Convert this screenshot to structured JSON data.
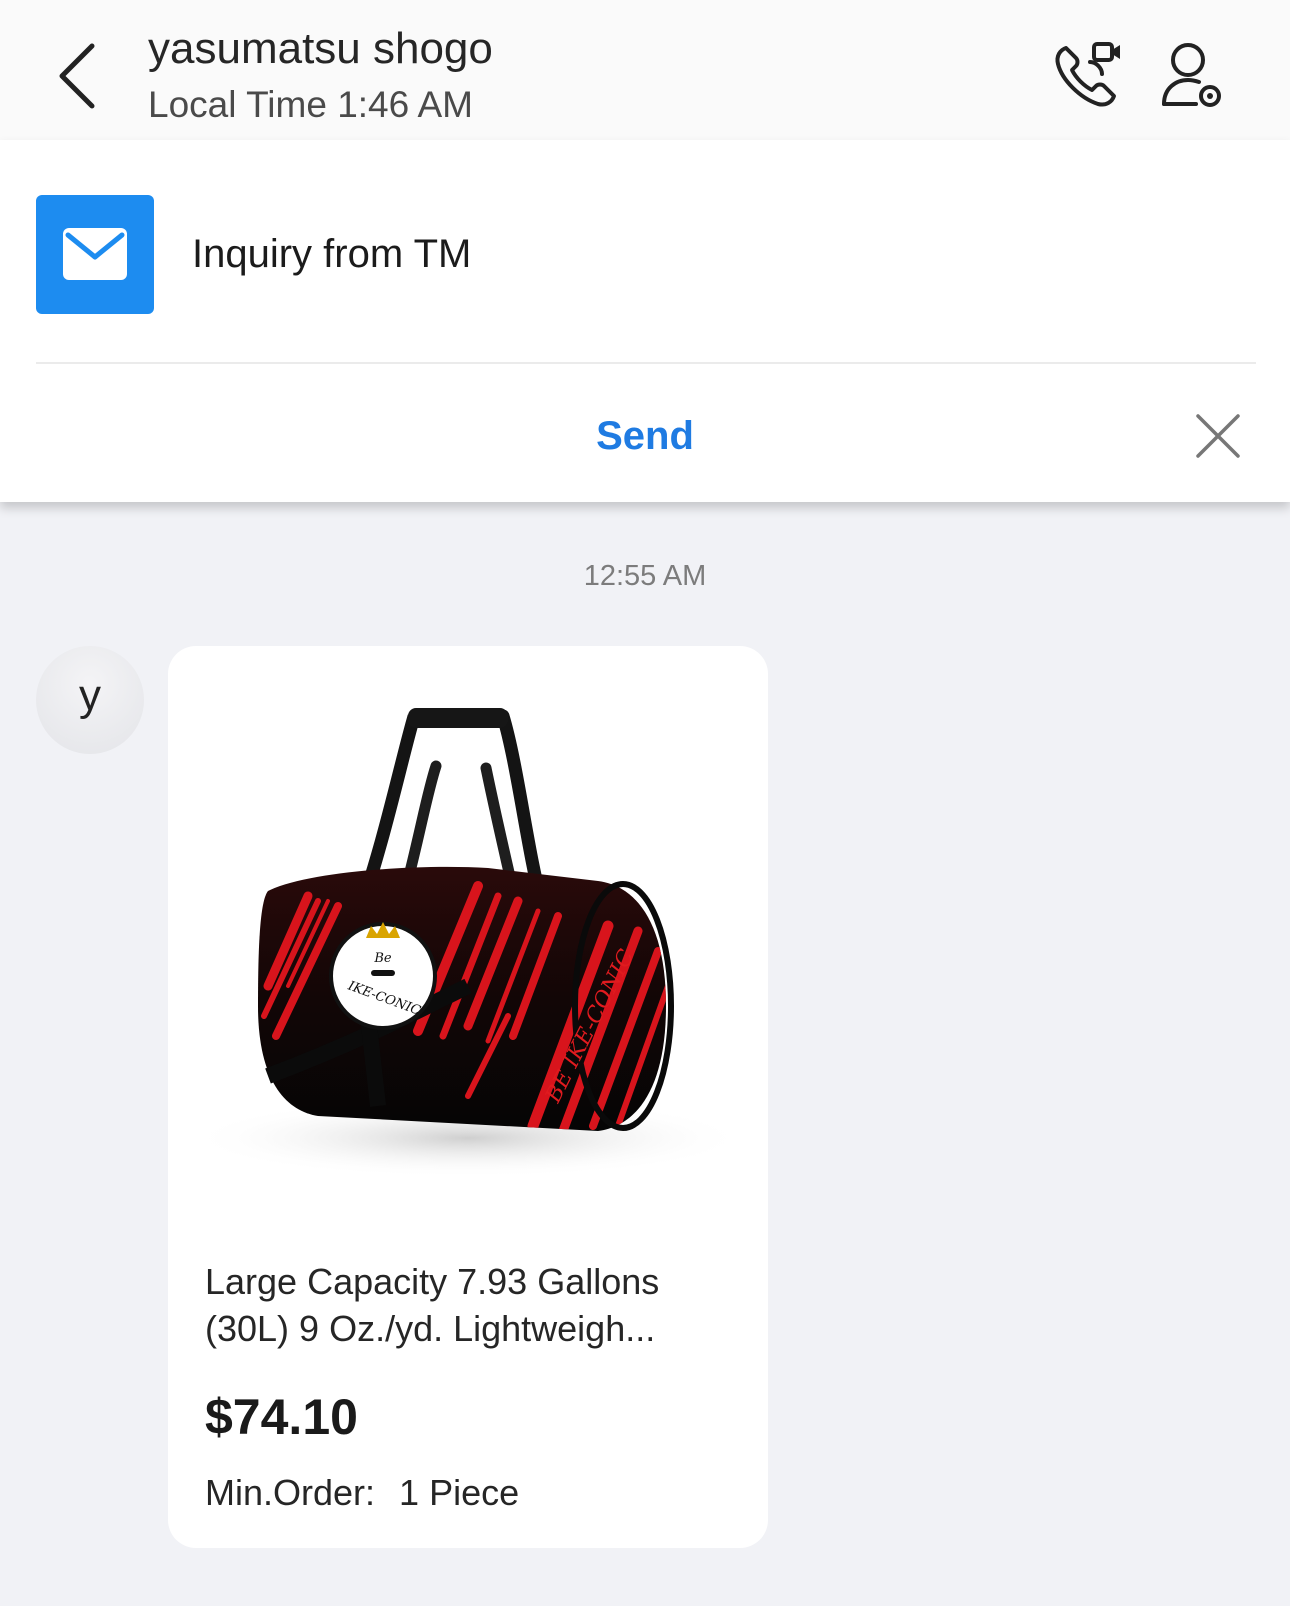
{
  "header": {
    "contact_name": "yasumatsu shogo",
    "local_time": "Local Time 1:46 AM",
    "back_icon": "chevron-left-icon",
    "call_icon": "phone-video-icon",
    "profile_icon": "user-settings-icon"
  },
  "sheet": {
    "icon": "mail-icon",
    "title": "Inquiry from TM",
    "send_label": "Send",
    "close_icon": "close-icon",
    "accent_color": "#1d8cf0",
    "send_color": "#1f7be2"
  },
  "conversation": {
    "timestamp": "12:55 AM",
    "avatar_letter": "y",
    "product": {
      "image_alt": "duffel-bag-photo",
      "logo_text": [
        "Be",
        "IKE-CONIC"
      ],
      "side_print": "BE IKE-CONIC",
      "title_line1": "Large Capacity 7.93 Gallons",
      "title_line2": "(30L) 9 Oz./yd. Lightweigh...",
      "price": "$74.10",
      "min_order_label": "Min.Order:",
      "min_order_value": "1 Piece"
    }
  }
}
